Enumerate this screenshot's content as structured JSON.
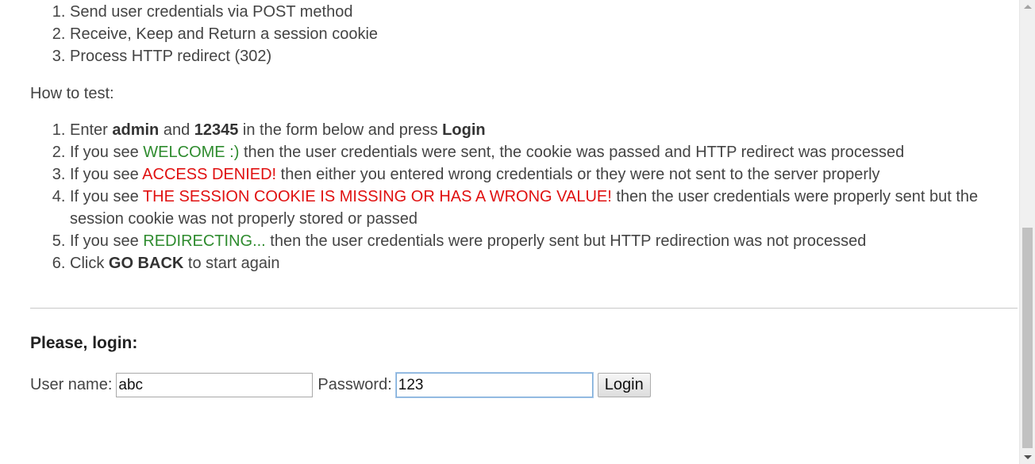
{
  "features": [
    "Send user credentials via POST method",
    "Receive, Keep and Return a session cookie",
    "Process HTTP redirect (302)"
  ],
  "how_to_test_label": "How to test:",
  "steps": {
    "s1": {
      "a": "Enter ",
      "b": "admin",
      "c": " and ",
      "d": "12345",
      "e": " in the form below and press ",
      "f": "Login"
    },
    "s2": {
      "a": "If you see ",
      "b": "WELCOME :)",
      "c": " then the user credentials were sent, the cookie was passed and HTTP redirect was processed"
    },
    "s3": {
      "a": "If you see ",
      "b": "ACCESS DENIED!",
      "c": " then either you entered wrong credentials or they were not sent to the server properly"
    },
    "s4": {
      "a": "If you see ",
      "b": "THE SESSION COOKIE IS MISSING OR HAS A WRONG VALUE!",
      "c": " then the user credentials were properly sent but the session cookie was not properly stored or passed"
    },
    "s5": {
      "a": "If you see ",
      "b": "REDIRECTING...",
      "c": " then the user credentials were properly sent but HTTP redirection was not processed"
    },
    "s6": {
      "a": "Click ",
      "b": "GO BACK",
      "c": " to start again"
    }
  },
  "login": {
    "title": "Please, login:",
    "username_label": "User name:",
    "username_value": "abc",
    "password_label": "Password:",
    "password_value": "123",
    "button_label": "Login"
  },
  "colors": {
    "success": "#2e8b2e",
    "error": "#e01010"
  }
}
